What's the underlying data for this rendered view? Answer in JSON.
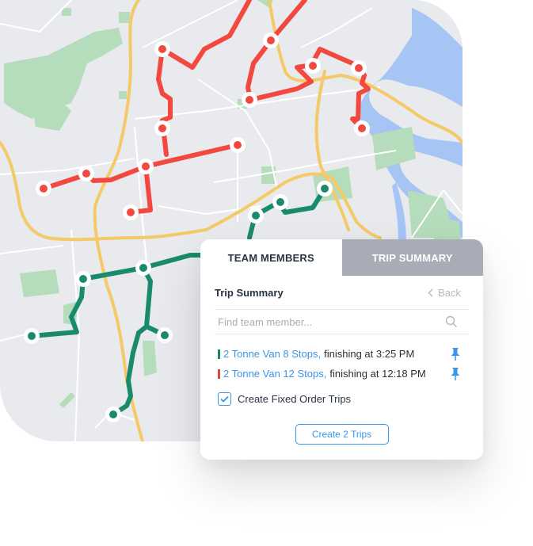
{
  "colors": {
    "route_red": "#f2483f",
    "route_green": "#1a8a6e",
    "accent_blue": "#3c95e6",
    "tab_inactive": "#a7acb6"
  },
  "map": {
    "routes": [
      {
        "name": "2 Tonne Van 12 Stops",
        "color": "red",
        "stop_count": 12
      },
      {
        "name": "2 Tonne Van 8 Stops",
        "color": "green",
        "stop_count": 8
      }
    ]
  },
  "panel": {
    "tabs": [
      {
        "label": "TEAM MEMBERS",
        "active": true
      },
      {
        "label": "TRIP SUMMARY",
        "active": false
      }
    ],
    "title": "Trip Summary",
    "back_label": "Back",
    "back_icon": "chevron-left-icon",
    "search": {
      "placeholder": "Find team member...",
      "value": "",
      "icon": "search-icon"
    },
    "trips": [
      {
        "name": "2 Tonne Van 8 Stops,",
        "detail": "finishing at 3:25 PM",
        "color": "#1a8a6e",
        "icon": "pin-icon"
      },
      {
        "name": "2 Tonne Van 12 Stops,",
        "detail": "finishing at 12:18 PM",
        "color": "#e0453b",
        "icon": "pin-icon"
      }
    ],
    "fixed_order": {
      "label": "Create Fixed Order Trips",
      "checked": true
    },
    "create_button": "Create 2 Trips"
  }
}
